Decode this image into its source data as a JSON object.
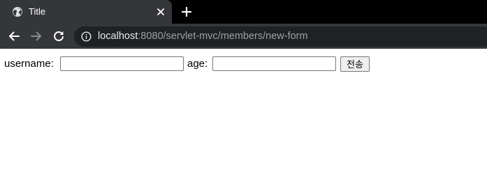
{
  "tab": {
    "title": "Title",
    "favicon": "globe-icon",
    "close_icon": "close-icon"
  },
  "new_tab_icon": "plus-icon",
  "toolbar": {
    "back_icon": "arrow-left-icon",
    "forward_icon": "arrow-right-icon",
    "reload_icon": "reload-icon",
    "info_icon": "info-icon",
    "url_host": "localhost",
    "url_rest": ":8080/servlet-mvc/members/new-form"
  },
  "form": {
    "username_label": "username:",
    "username_value": "",
    "age_label": "age:",
    "age_value": "",
    "submit_label": "전송"
  },
  "colors": {
    "tabstrip_bg": "#000000",
    "toolbar_bg": "#35363a",
    "omnibox_bg": "#202124",
    "url_host": "#e8eaed",
    "url_path": "#9aa0a6",
    "page_bg": "#ffffff"
  }
}
